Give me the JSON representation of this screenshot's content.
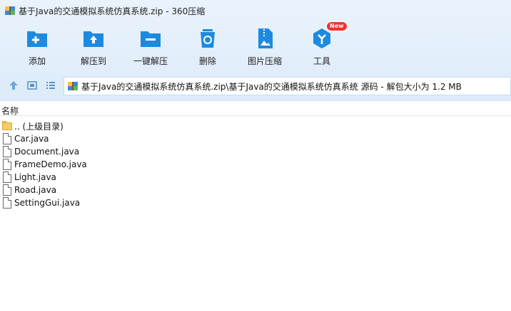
{
  "window": {
    "title": "基于Java的交通模拟系统仿真系统.zip - 360压缩"
  },
  "toolbar": {
    "items": [
      {
        "label": "添加",
        "icon": "add-folder-icon"
      },
      {
        "label": "解压到",
        "icon": "extract-to-icon"
      },
      {
        "label": "一键解压",
        "icon": "one-click-extract-icon"
      },
      {
        "label": "删除",
        "icon": "recycle-bin-icon"
      },
      {
        "label": "图片压缩",
        "icon": "image-compress-icon"
      },
      {
        "label": "工具",
        "icon": "tools-icon",
        "badge": "New"
      }
    ]
  },
  "nav": {
    "address": "基于Java的交通模拟系统仿真系统.zip\\基于Java的交通模拟系统仿真系统 源码 - 解包大小为 1.2 MB"
  },
  "list": {
    "column_name": "名称",
    "parent_label": ".. (上级目录)",
    "files": [
      "Car.java",
      "Document.java",
      "FrameDemo.java",
      "Light.java",
      "Road.java",
      "SettingGui.java"
    ]
  },
  "colors": {
    "accent": "#1d8ae0",
    "toolbar_bg": "#dcebf9",
    "badge": "#e33333"
  }
}
